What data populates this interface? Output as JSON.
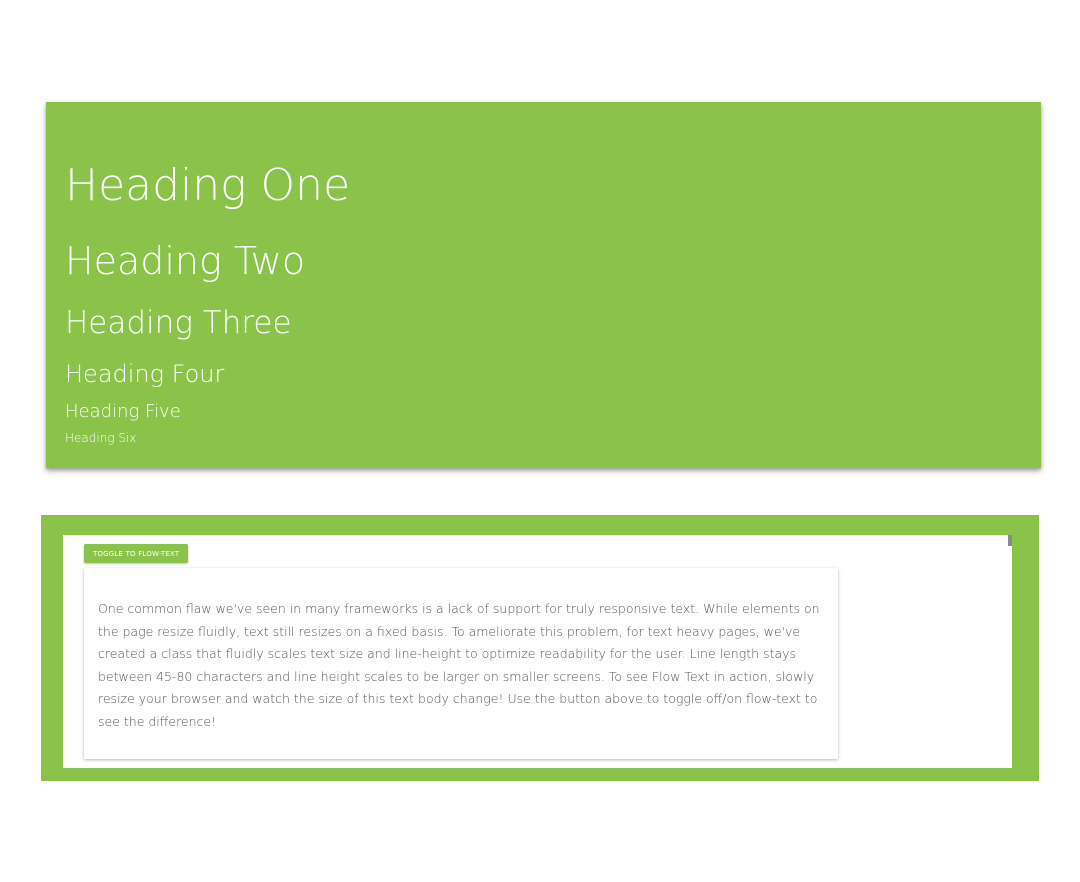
{
  "headings": {
    "h1": "Heading One",
    "h2": "Heading Two",
    "h3": "Heading Three",
    "h4": "Heading Four",
    "h5": "Heading Five",
    "h6": "Heading Six"
  },
  "flow_text": {
    "toggle_label": "TOGGLE TO FLOW-TEXT",
    "body": "One common flaw we've seen in many frameworks is a lack of support for truly responsive text. While elements on the page resize fluidly, text still resizes on a fixed basis. To ameliorate this problem, for text heavy pages, we've created a class that fluidly scales text size and line-height to optimize readability for the user. Line length stays between 45-80 characters and line height scales to be larger on smaller screens. To see Flow Text in action, slowly resize your browser and watch the size of this text body change! Use the button above to toggle off/on flow-text to see the difference!"
  },
  "colors": {
    "accent": "#8bc34a",
    "text_muted": "#555555",
    "heading_text": "#ffffff"
  }
}
